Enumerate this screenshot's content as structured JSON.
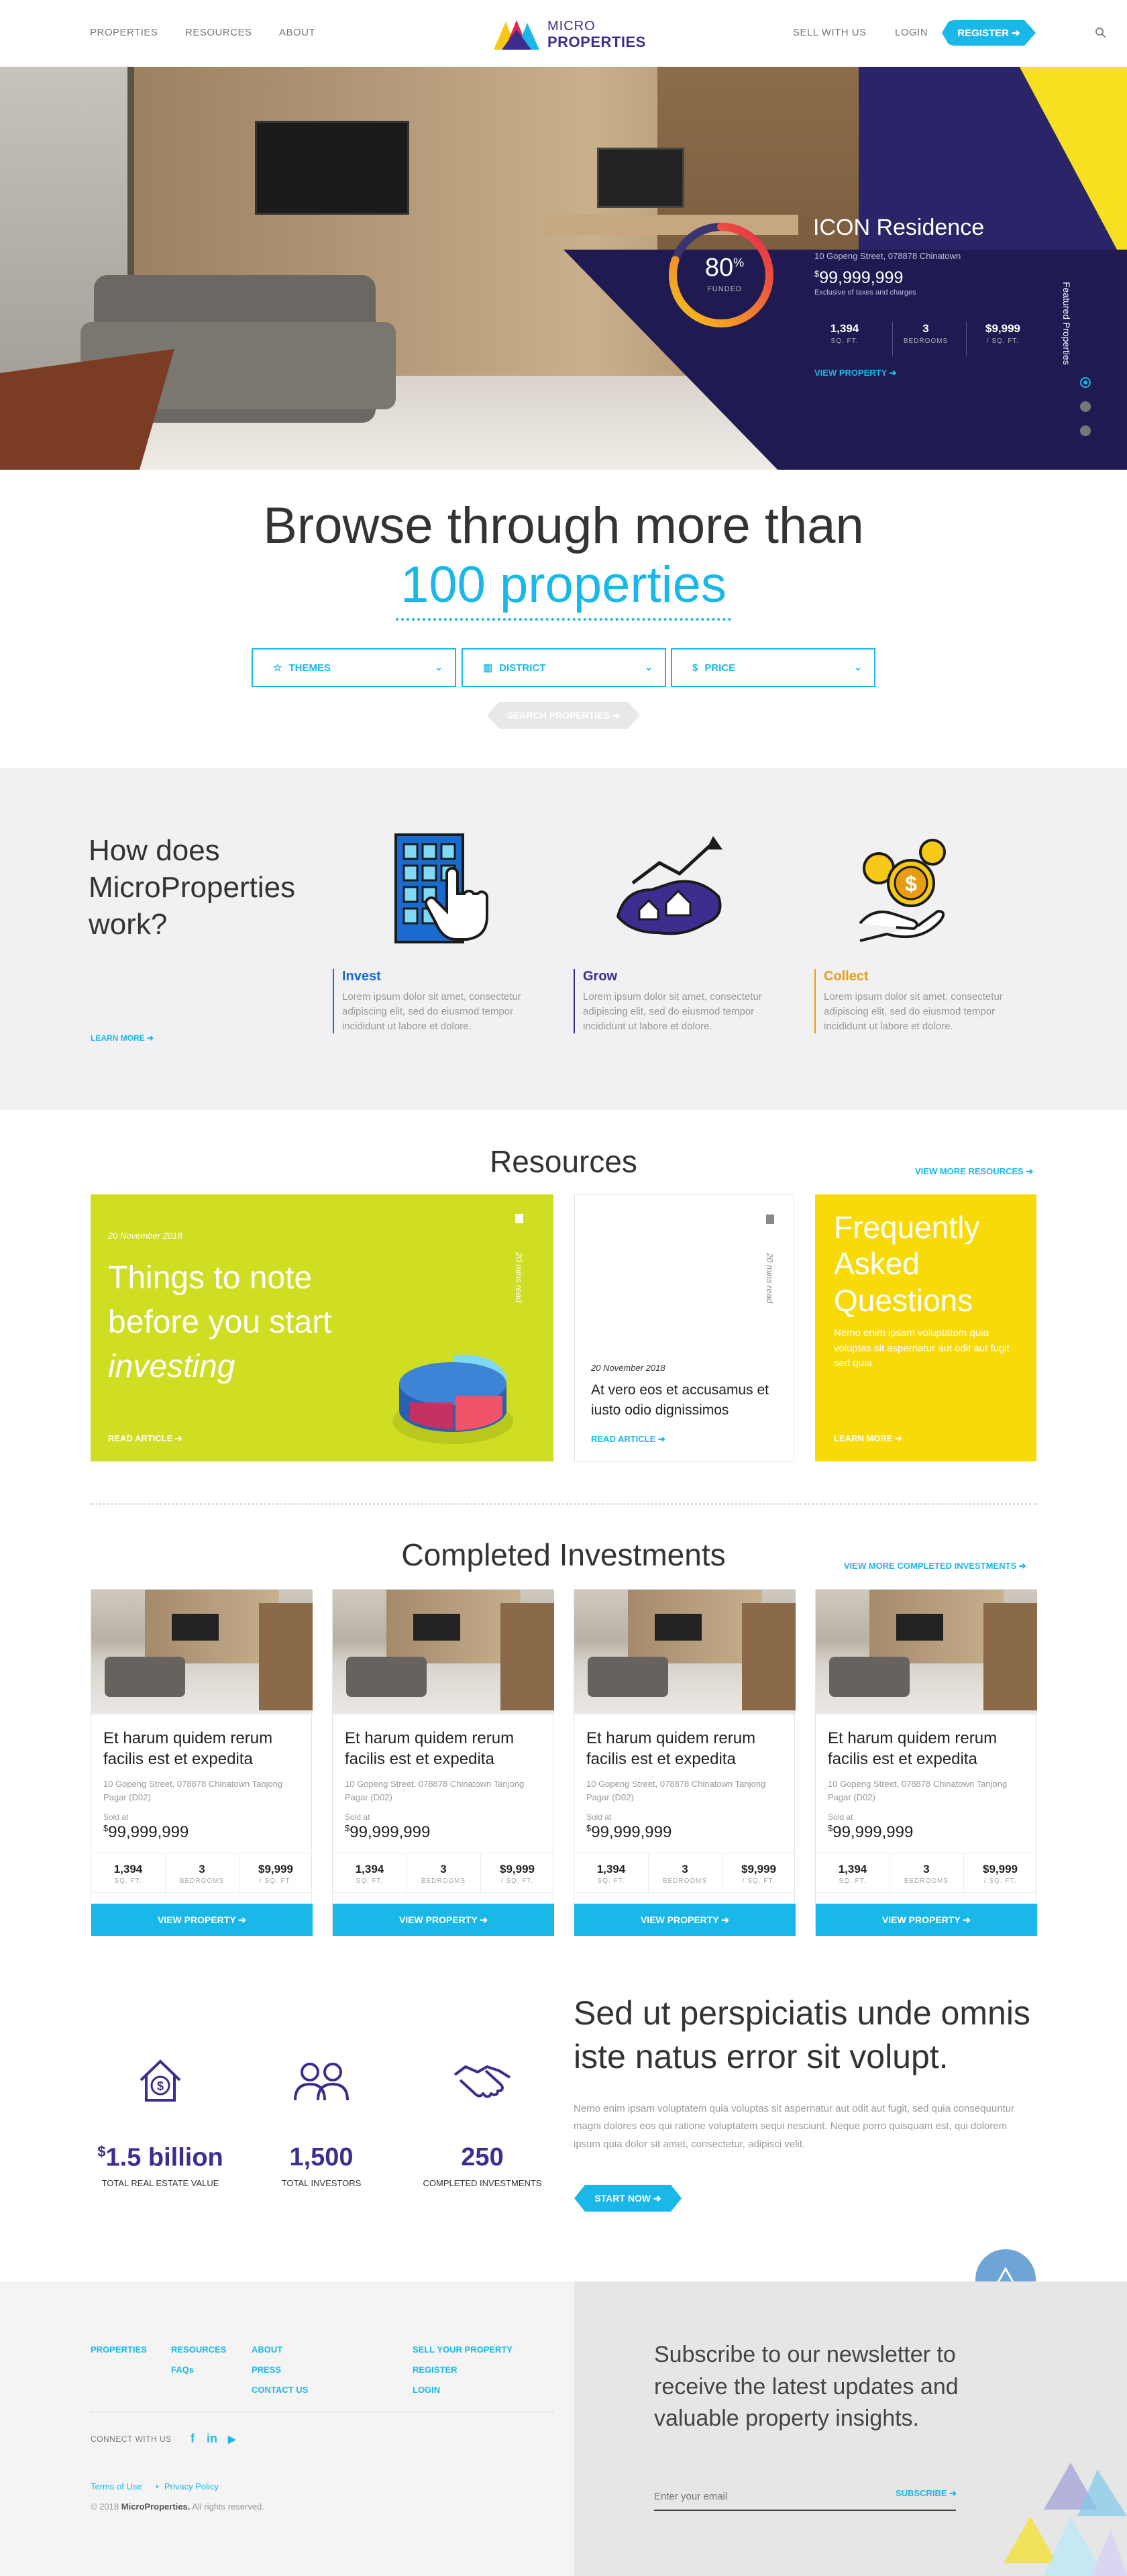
{
  "nav": {
    "properties": "PROPERTIES",
    "resources": "RESOURCES",
    "about": "ABOUT",
    "logo_line1": "MICRO",
    "logo_line2": "PROPERTIES",
    "sell": "SELL WITH US",
    "login": "LOGIN",
    "register": "REGISTER ➔",
    "search_icon": "search-icon"
  },
  "hero": {
    "funded_pct": "80",
    "funded_pct_value": 0.8,
    "funded_label": "FUNDED",
    "title": "ICON Residence",
    "address": "10 Gopeng Street, 078878 Chinatown",
    "price": "99,999,999",
    "price_note": "Exclusive of taxes and charges",
    "stats": [
      {
        "value": "1,394",
        "label": "SQ. FT."
      },
      {
        "value": "3",
        "label": "BEDROOMS"
      },
      {
        "value": "$9,999",
        "label": "/ SQ. FT."
      }
    ],
    "view_link": "VIEW PROPERTY ➔",
    "featured_label": "Featured Properties",
    "colors": {
      "panel": "#1f1b52",
      "accent": "#1ab8e8"
    }
  },
  "browse": {
    "line1": "Browse through more than",
    "line2": "100 properties",
    "filters": [
      "THEMES",
      "DISTRICT",
      "PRICE"
    ],
    "search_button": "SEARCH PROPERTIES ➔"
  },
  "how": {
    "title": "How does MicroProperties work?",
    "learn_more": "LEARN MORE ➔",
    "steps": [
      {
        "title": "Invest",
        "text": "Lorem ipsum dolor sit amet, consectetur adipiscing elit, sed do eiusmod tempor incididunt ut labore et dolore.",
        "color": "#1a6bd0"
      },
      {
        "title": "Grow",
        "text": "Lorem ipsum dolor sit amet, consectetur adipiscing elit, sed do eiusmod tempor incididunt ut labore et dolore.",
        "color": "#3b2e8f"
      },
      {
        "title": "Collect",
        "text": "Lorem ipsum dolor sit amet, consectetur adipiscing elit, sed do eiusmod tempor incididunt ut labore et dolore.",
        "color": "#e89c12"
      }
    ]
  },
  "resources": {
    "title": "Resources",
    "view_more": "VIEW MORE RESOURCES ➔",
    "feature": {
      "date": "20 November 2018",
      "title_a": "Things to note before you start",
      "title_b": "investing",
      "read": "20 mins read",
      "link": "READ ARTICLE ➔"
    },
    "article": {
      "date": "20 November 2018",
      "title": "At vero eos et accusamus et iusto odio dignissimos",
      "read": "20 mins read",
      "link": "READ ARTICLE ➔"
    },
    "faq": {
      "title": "Frequently Asked Questions",
      "text": "Nemo enim ipsam voluptatem quia voluptas sit aspernatur aut odit aut fugit sed quia",
      "link": "LEARN MORE ➔"
    }
  },
  "completed": {
    "title": "Completed Investments",
    "view_more": "VIEW MORE COMPLETED INVESTMENTS ➔",
    "cards": [
      {
        "title": "Et harum quidem rerum facilis est et expedita",
        "address": "10 Gopeng Street, 078878 Chinatown Tanjong Pagar (D02)",
        "sold": "Sold at",
        "price": "99,999,999",
        "sqft": "1,394",
        "sqft_l": "SQ. FT.",
        "beds": "3",
        "beds_l": "BEDROOMS",
        "psf": "$9,999",
        "psf_l": "/ SQ. FT.",
        "button": "VIEW PROPERTY ➔"
      },
      {
        "title": "Et harum quidem rerum facilis est et expedita",
        "address": "10 Gopeng Street, 078878 Chinatown Tanjong Pagar (D02)",
        "sold": "Sold at",
        "price": "99,999,999",
        "sqft": "1,394",
        "sqft_l": "SQ. FT.",
        "beds": "3",
        "beds_l": "BEDROOMS",
        "psf": "$9,999",
        "psf_l": "/ SQ. FT.",
        "button": "VIEW PROPERTY ➔"
      },
      {
        "title": "Et harum quidem rerum facilis est et expedita",
        "address": "10 Gopeng Street, 078878 Chinatown Tanjong Pagar (D02)",
        "sold": "Sold at",
        "price": "99,999,999",
        "sqft": "1,394",
        "sqft_l": "SQ. FT.",
        "beds": "3",
        "beds_l": "BEDROOMS",
        "psf": "$9,999",
        "psf_l": "/ SQ. FT.",
        "button": "VIEW PROPERTY ➔"
      },
      {
        "title": "Et harum quidem rerum facilis est et expedita",
        "address": "10 Gopeng Street, 078878 Chinatown Tanjong Pagar (D02)",
        "sold": "Sold at",
        "price": "99,999,999",
        "sqft": "1,394",
        "sqft_l": "SQ. FT.",
        "beds": "3",
        "beds_l": "BEDROOMS",
        "psf": "$9,999",
        "psf_l": "/ SQ. FT.",
        "button": "VIEW PROPERTY ➔"
      }
    ]
  },
  "stats": {
    "items": [
      {
        "value": "1.5 billion",
        "prefix": "$",
        "label": "TOTAL REAL ESTATE VALUE",
        "icon": "house-dollar-icon"
      },
      {
        "value": "1,500",
        "prefix": "",
        "label": "TOTAL INVESTORS",
        "icon": "users-icon"
      },
      {
        "value": "250",
        "prefix": "",
        "label": "COMPLETED INVESTMENTS",
        "icon": "handshake-icon"
      }
    ],
    "heading": "Sed ut perspiciatis unde omnis iste natus error sit volupt.",
    "text": "Nemo enim ipsam voluptatem quia voluptas sit aspernatur aut odit aut fugit, sed quia consequuntur magni dolores eos qui ratione voluptatem sequi nesciunt. Neque porro quisquam est, qui dolorem ipsum quia dolor sit amet, consectetur, adipisci velit.",
    "button": "START NOW ➔"
  },
  "footer": {
    "links": {
      "properties": "PROPERTIES",
      "resources": "RESOURCES",
      "faqs": "FAQs",
      "about": "ABOUT",
      "press": "PRESS",
      "contact": "CONTACT US",
      "sell": "SELL YOUR PROPERTY",
      "register": "REGISTER",
      "login": "LOGIN"
    },
    "connect": "CONNECT WITH US",
    "social": [
      "f",
      "in",
      "▶"
    ],
    "terms": "Terms of Use",
    "privacy": "Privacy Policy",
    "copyright_prefix": "© 2018",
    "copyright_brand": "MicroProperties.",
    "copyright_suffix": "All rights reserved.",
    "newsletter": "Subscribe to our newsletter to receive the latest updates and valuable property insights.",
    "email_placeholder": "Enter your email",
    "subscribe": "SUBSCRIBE ➔"
  }
}
